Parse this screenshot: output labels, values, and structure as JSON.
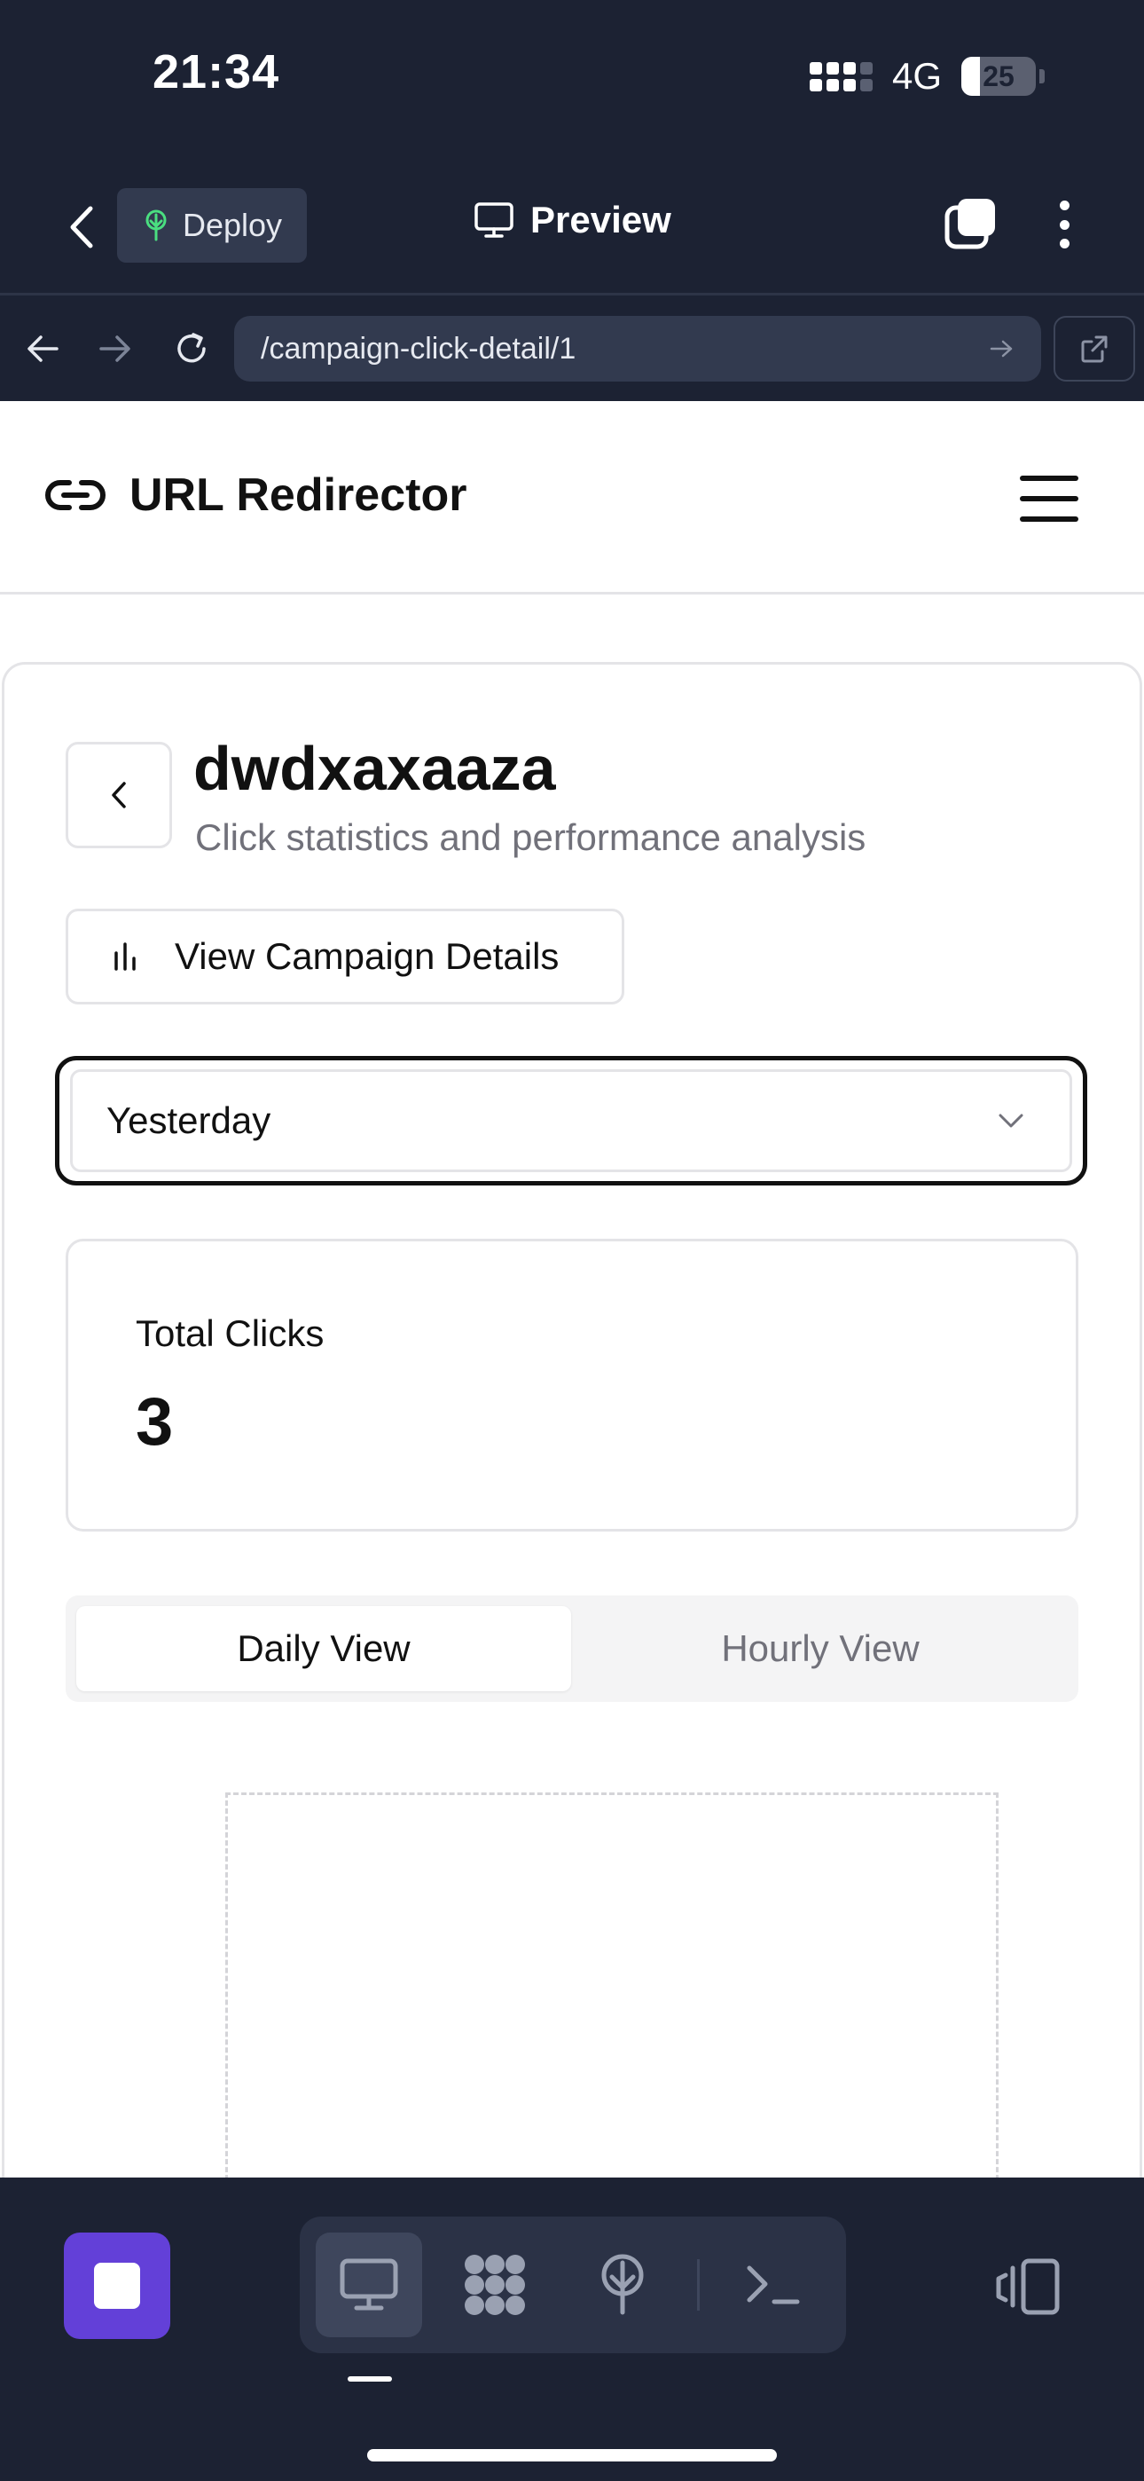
{
  "status_bar": {
    "time": "21:34",
    "network": "4G",
    "battery_level": "25",
    "battery_fraction": 0.25
  },
  "toolbar": {
    "deploy_label": "Deploy",
    "preview_label": "Preview"
  },
  "browser": {
    "url": "/campaign-click-detail/1"
  },
  "app": {
    "title": "URL Redirector"
  },
  "campaign": {
    "name": "dwdxaxaaza",
    "subtitle": "Click statistics and performance analysis",
    "details_button_label": "View Campaign Details"
  },
  "date_filter": {
    "selected": "Yesterday"
  },
  "stats": {
    "total_clicks_label": "Total Clicks",
    "total_clicks_value": "3"
  },
  "view_tabs": [
    {
      "label": "Daily View",
      "active": true
    },
    {
      "label": "Hourly View",
      "active": false
    }
  ],
  "colors": {
    "chrome_bg": "#1c2233",
    "accent_purple": "#6340d8",
    "deploy_icon_green": "#4ade80",
    "text_primary": "#111111",
    "text_muted": "#71717a",
    "border": "#e4e4e7"
  },
  "icons": {
    "back": "chevron-left-icon",
    "deploy": "tree-icon",
    "preview": "monitor-icon",
    "tabs": "tabs-icon",
    "more": "more-vertical-icon",
    "brand": "link-icon",
    "menu": "hamburger-icon",
    "details": "bar-chart-icon",
    "dropdown": "chevron-down-icon",
    "dock": [
      "monitor-icon",
      "blocks-icon",
      "tree-icon",
      "terminal-icon"
    ]
  }
}
